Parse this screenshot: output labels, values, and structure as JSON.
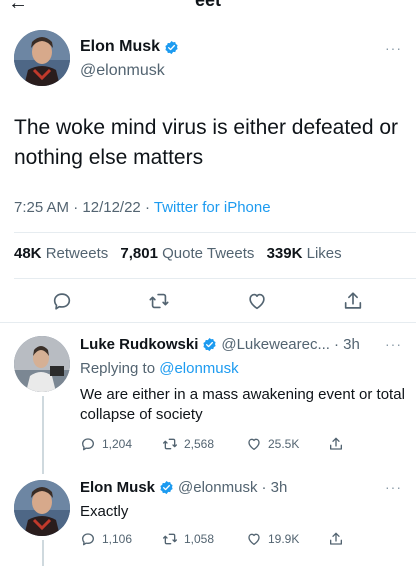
{
  "header": {
    "title": "eet"
  },
  "main_tweet": {
    "author_name": "Elon Musk",
    "author_handle": "@elonmusk",
    "text": "The woke mind virus is either defeated or nothing else matters",
    "time": "7:25 AM",
    "date": "12/12/22",
    "source": "Twitter for iPhone",
    "stats": {
      "retweets_count": "48K",
      "retweets_label": "Retweets",
      "quotes_count": "7,801",
      "quotes_label": "Quote Tweets",
      "likes_count": "339K",
      "likes_label": "Likes"
    }
  },
  "replies": [
    {
      "author_name": "Luke Rudkowski",
      "author_handle": "@Lukewearec...",
      "time": "· 3h",
      "replying_prefix": "Replying to",
      "replying_to": "@elonmusk",
      "text": "We are either in a mass awakening event or total collapse of society",
      "reply_count": "1,204",
      "retweet_count": "2,568",
      "like_count": "25.5K"
    },
    {
      "author_name": "Elon Musk",
      "author_handle": "@elonmusk",
      "time": "· 3h",
      "text": "Exactly",
      "reply_count": "1,106",
      "retweet_count": "1,058",
      "like_count": "19.9K"
    }
  ],
  "icons": [
    "back-arrow-icon",
    "more-icon",
    "verified-badge-icon",
    "reply-icon",
    "retweet-icon",
    "like-icon",
    "share-icon"
  ],
  "colors": {
    "accent": "#1d9bf0",
    "text": "#0f1419",
    "secondary": "#536471",
    "divider": "#e6ecf0"
  }
}
